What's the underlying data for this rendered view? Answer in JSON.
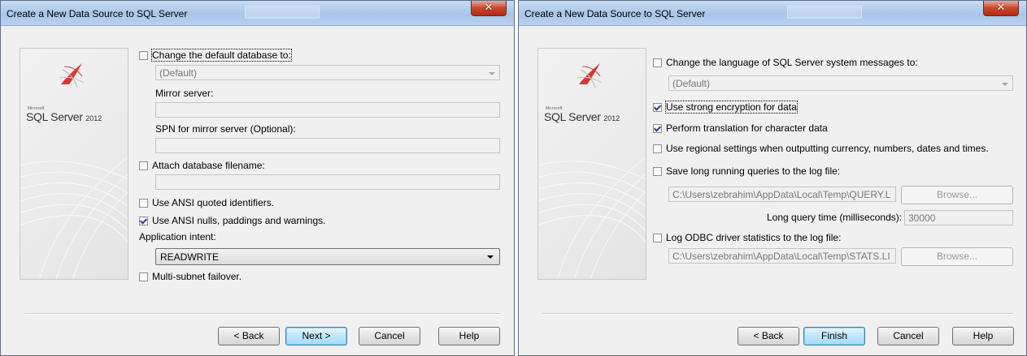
{
  "left": {
    "title": "Create a New Data Source to SQL Server",
    "close_glyph": "✕",
    "logo": {
      "microsoft": "Microsoft",
      "brand": "SQL Server",
      "version": "2012"
    },
    "change_db": {
      "label": "Change the default database to:",
      "checked": false
    },
    "default_db_value": "(Default)",
    "mirror_label": "Mirror server:",
    "mirror_value": "",
    "spn_label": "SPN for mirror server (Optional):",
    "spn_value": "",
    "attach": {
      "label": "Attach database filename:",
      "checked": false
    },
    "attach_value": "",
    "ansi_quoted": {
      "label": "Use ANSI quoted identifiers.",
      "checked": false
    },
    "ansi_nulls": {
      "label": "Use ANSI nulls, paddings and warnings.",
      "checked": true
    },
    "intent_label": "Application intent:",
    "intent_value": "READWRITE",
    "multisubnet": {
      "label": "Multi-subnet failover.",
      "checked": false
    },
    "buttons": {
      "back": "< Back",
      "next": "Next >",
      "cancel": "Cancel",
      "help": "Help"
    }
  },
  "right": {
    "title": "Create a New Data Source to SQL Server",
    "close_glyph": "✕",
    "logo": {
      "microsoft": "Microsoft",
      "brand": "SQL Server",
      "version": "2012"
    },
    "change_lang": {
      "label": "Change the language of SQL Server system messages to:",
      "checked": false
    },
    "lang_value": "(Default)",
    "strong_enc": {
      "label": "Use strong encryption for data",
      "checked": true
    },
    "translation": {
      "label": "Perform translation for character data",
      "checked": true
    },
    "regional": {
      "label": "Use regional settings when outputting currency, numbers, dates and times.",
      "checked": false
    },
    "save_long": {
      "label": "Save long running queries to the log file:",
      "checked": false
    },
    "query_log_path": "C:\\Users\\zebrahim\\AppData\\Local\\Temp\\QUERY.L",
    "browse1": "Browse...",
    "long_query_label": "Long query time (milliseconds):",
    "long_query_value": "30000",
    "log_odbc": {
      "label": "Log ODBC driver statistics to the log file:",
      "checked": false
    },
    "stats_log_path": "C:\\Users\\zebrahim\\AppData\\Local\\Temp\\STATS.LI",
    "browse2": "Browse...",
    "buttons": {
      "back": "< Back",
      "finish": "Finish",
      "cancel": "Cancel",
      "help": "Help"
    }
  }
}
